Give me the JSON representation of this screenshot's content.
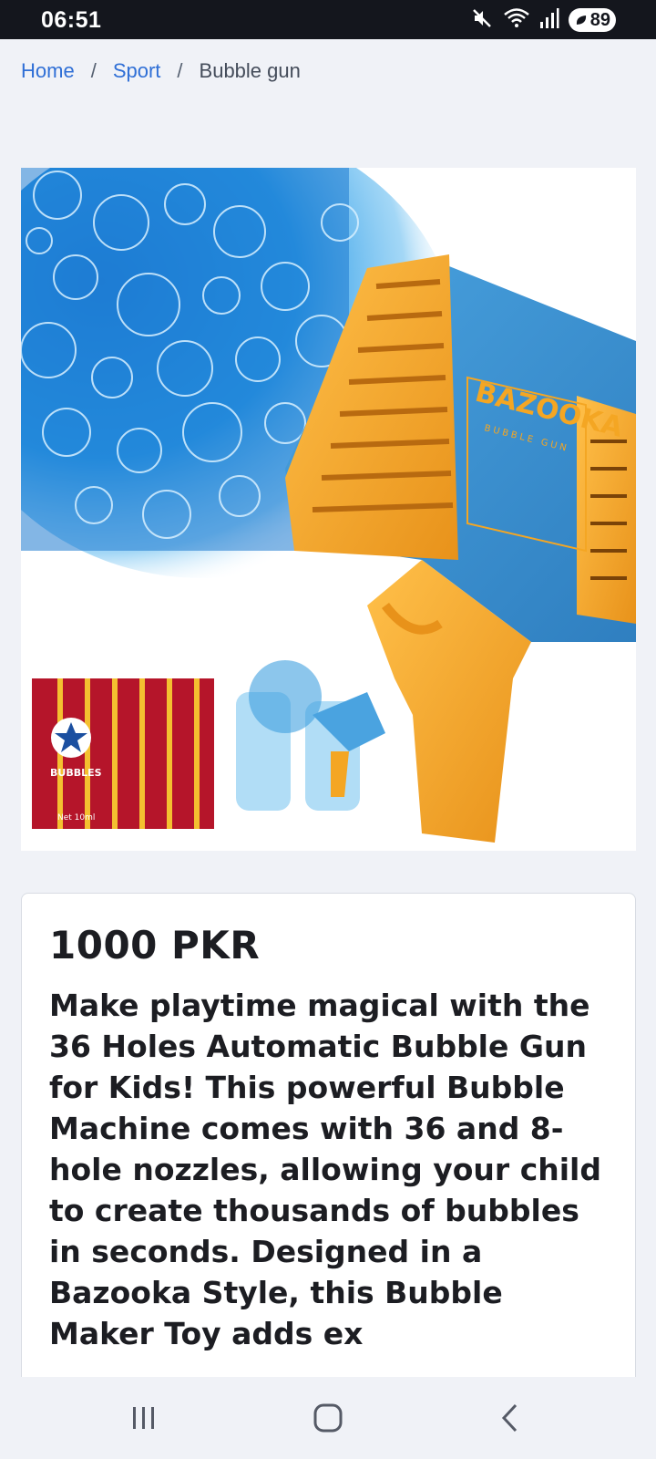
{
  "status_bar": {
    "time": "06:51",
    "battery_level": "89",
    "icons": [
      "mute-icon",
      "wifi-icon",
      "signal-icon",
      "battery-saver-icon"
    ]
  },
  "breadcrumb": {
    "items": [
      {
        "label": "Home"
      },
      {
        "label": "Sport"
      }
    ],
    "separator": "/",
    "current": "Bubble gun"
  },
  "product": {
    "image_brand_text": "BAZOOKA",
    "image_sub_text": "BUBBLE GUN",
    "pack_label": "BUBBLES",
    "pack_net": "Net 10ml",
    "price": "1000 PKR",
    "description": "Make playtime magical with the 36 Holes Automatic Bubble Gun for Kids! This powerful Bubble Machine comes with 36 and 8-hole nozzles, allowing your child to create thousands of bubbles in seconds. Designed in a Bazooka Style, this Bubble Maker Toy adds ex"
  },
  "colors": {
    "link": "#2f6fd6",
    "gun_body": "#3d8fd0",
    "gun_accent": "#f4a623",
    "page_bg": "#f0f2f7"
  },
  "nav_bar": {
    "icons": [
      "recent-apps-icon",
      "home-icon",
      "back-icon"
    ]
  }
}
